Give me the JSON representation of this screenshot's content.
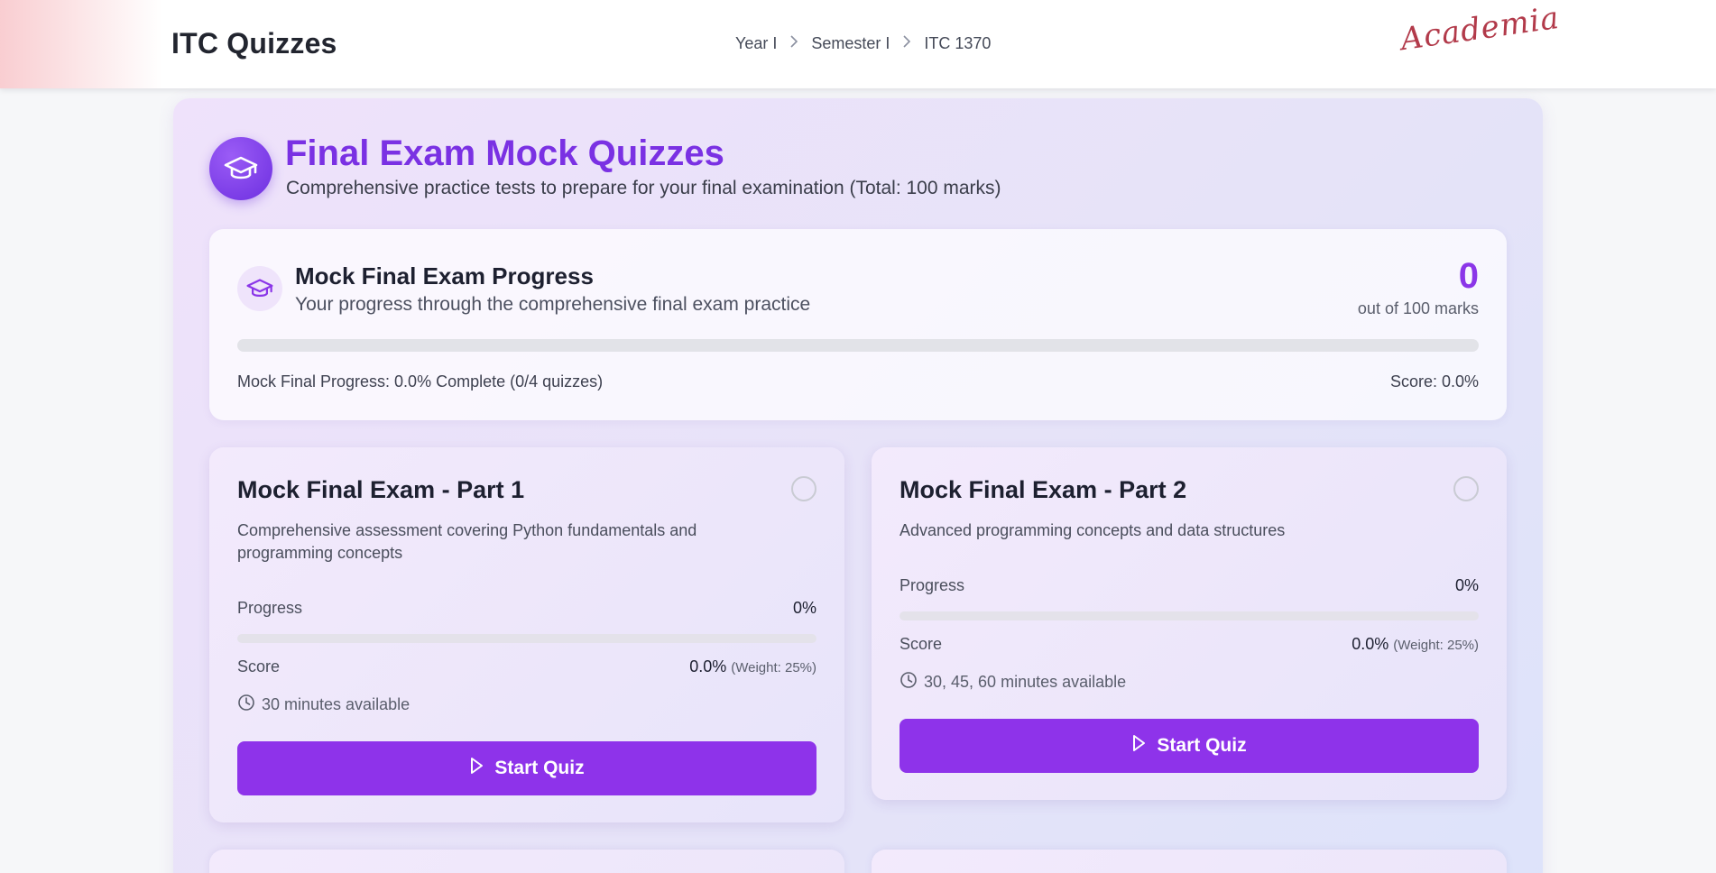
{
  "header": {
    "site_title": "ITC Quizzes",
    "breadcrumb": [
      "Year I",
      "Semester I",
      "ITC 1370"
    ],
    "breadcrumb_separator": ">",
    "logo_text": "Academia"
  },
  "hero": {
    "icon": "graduation-cap-icon",
    "title": "Final Exam Mock Quizzes",
    "subtitle": "Comprehensive practice tests to prepare for your final examination (Total: 100 marks)"
  },
  "progress": {
    "icon": "graduation-cap-icon",
    "title": "Mock Final Exam Progress",
    "subtitle": "Your progress through the comprehensive final exam practice",
    "score": "0",
    "score_caption": "out of 100 marks",
    "percent": 0,
    "footer_left": "Mock Final Progress: 0.0% Complete (0/4 quizzes)",
    "footer_right": "Score: 0.0%"
  },
  "quizzes": [
    {
      "title": "Mock Final Exam - Part 1",
      "description": "Comprehensive assessment covering Python fundamentals and programming concepts",
      "progress_label": "Progress",
      "progress_value": "0%",
      "progress_percent": 0,
      "score_label": "Score",
      "score_value": "0.0%",
      "weight": "(Weight: 25%)",
      "time": "30 minutes available",
      "button_label": "Start Quiz"
    },
    {
      "title": "Mock Final Exam - Part 2",
      "description": "Advanced programming concepts and data structures",
      "progress_label": "Progress",
      "progress_value": "0%",
      "progress_percent": 0,
      "score_label": "Score",
      "score_value": "0.0%",
      "weight": "(Weight: 25%)",
      "time": "30, 45, 60 minutes available",
      "button_label": "Start Quiz"
    }
  ],
  "colors": {
    "accent": "#8e33ea",
    "title_purple": "#7a31e3",
    "logo_red": "#b23a4a"
  }
}
